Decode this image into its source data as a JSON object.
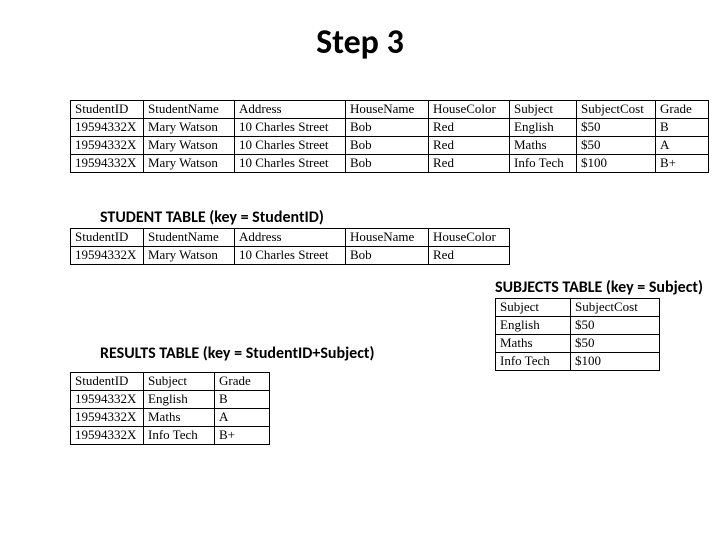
{
  "title": "Step 3",
  "captions": {
    "student": "STUDENT TABLE (key = StudentID)",
    "subjects": "SUBJECTS TABLE (key = Subject)",
    "results": "RESULTS TABLE (key = StudentID+Subject)"
  },
  "table1": {
    "headers": [
      "StudentID",
      "StudentName",
      "Address",
      "HouseName",
      "HouseColor",
      "Subject",
      "SubjectCost",
      "Grade"
    ],
    "rows": [
      [
        "19594332X",
        "Mary Watson",
        "10 Charles Street",
        "Bob",
        "Red",
        "English",
        "$50",
        "B"
      ],
      [
        "19594332X",
        "Mary Watson",
        "10 Charles Street",
        "Bob",
        "Red",
        "Maths",
        "$50",
        "A"
      ],
      [
        "19594332X",
        "Mary Watson",
        "10 Charles Street",
        "Bob",
        "Red",
        "Info Tech",
        "$100",
        "B+"
      ]
    ]
  },
  "table2": {
    "headers": [
      "StudentID",
      "StudentName",
      "Address",
      "HouseName",
      "HouseColor"
    ],
    "rows": [
      [
        "19594332X",
        "Mary Watson",
        "10 Charles Street",
        "Bob",
        "Red"
      ]
    ]
  },
  "table3": {
    "headers": [
      "Subject",
      "SubjectCost"
    ],
    "rows": [
      [
        "English",
        "$50"
      ],
      [
        "Maths",
        "$50"
      ],
      [
        "Info Tech",
        "$100"
      ]
    ]
  },
  "table4": {
    "headers": [
      "StudentID",
      "Subject",
      "Grade"
    ],
    "rows": [
      [
        "19594332X",
        "English",
        "B"
      ],
      [
        "19594332X",
        "Maths",
        "A"
      ],
      [
        "19594332X",
        "Info Tech",
        "B+"
      ]
    ]
  }
}
